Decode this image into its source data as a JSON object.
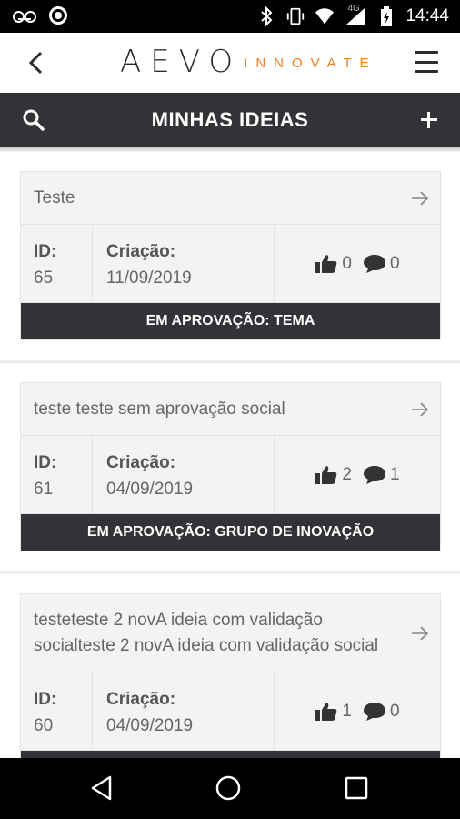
{
  "status_bar": {
    "time": "14:44",
    "network": "4G"
  },
  "header": {
    "logo_main": "AEVO",
    "logo_sub": "INNOVATE"
  },
  "titlebar": {
    "title": "MINHAS IDEIAS"
  },
  "labels": {
    "id": "ID:",
    "created": "Criação:"
  },
  "ideas": [
    {
      "title": "Teste",
      "id": "65",
      "date": "11/09/2019",
      "likes": "0",
      "comments": "0",
      "status": "EM APROVAÇÃO: TEMA"
    },
    {
      "title": "teste teste sem aprovação social",
      "id": "61",
      "date": "04/09/2019",
      "likes": "2",
      "comments": "1",
      "status": "EM APROVAÇÃO: GRUPO DE INOVAÇÃO"
    },
    {
      "title": "testeteste 2 novA ideia com validação socialteste 2 novA ideia com validação social",
      "id": "60",
      "date": "04/09/2019",
      "likes": "1",
      "comments": "0",
      "status": ""
    }
  ],
  "colors": {
    "dark_bar": "#333237",
    "brand_orange": "#e8822a"
  }
}
